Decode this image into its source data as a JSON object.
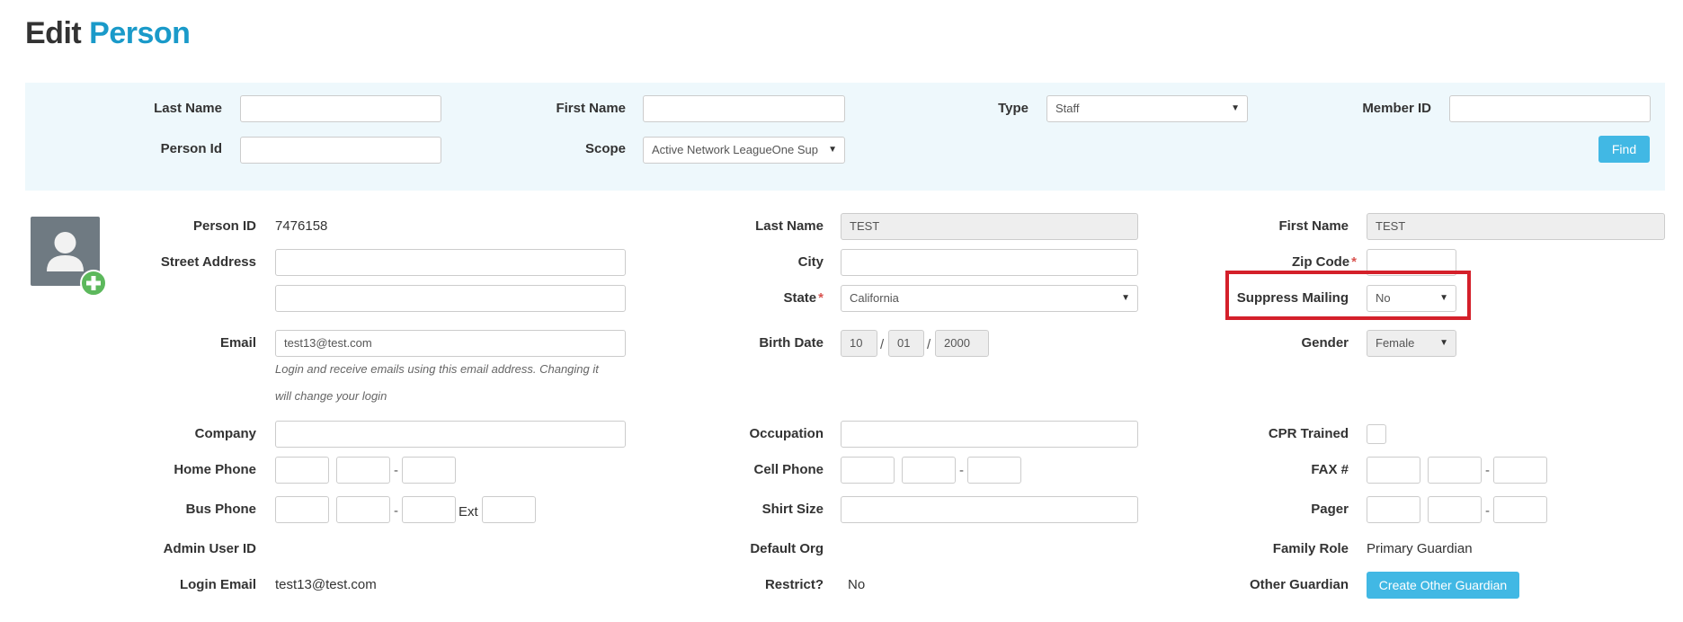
{
  "page": {
    "title_word1": "Edit",
    "title_word2": "Person"
  },
  "search": {
    "last_name_label": "Last Name",
    "last_name_value": "",
    "first_name_label": "First Name",
    "first_name_value": "",
    "type_label": "Type",
    "type_value": "Staff",
    "member_id_label": "Member ID",
    "member_id_value": "",
    "person_id_label": "Person Id",
    "person_id_value": "",
    "scope_label": "Scope",
    "scope_value": "Active Network LeagueOne Sup",
    "find_button": "Find"
  },
  "person": {
    "person_id_label": "Person ID",
    "person_id_value": "7476158",
    "street_address_label": "Street Address",
    "street_address_1": "",
    "street_address_2": "",
    "email_label": "Email",
    "email_value": "test13@test.com",
    "email_note_line1": "Login and receive emails using this email address. Changing it",
    "email_note_line2": "will change your login",
    "company_label": "Company",
    "company_value": "",
    "home_phone_label": "Home Phone",
    "bus_phone_label": "Bus Phone",
    "ext_label": "Ext",
    "admin_user_id_label": "Admin User ID",
    "login_email_label": "Login Email",
    "login_email_value": "test13@test.com",
    "last_name_label": "Last Name",
    "last_name_value": "TEST",
    "city_label": "City",
    "city_value": "",
    "state_label": "State",
    "state_value": "California",
    "birth_date_label": "Birth Date",
    "birth_month": "10",
    "birth_day": "01",
    "birth_year": "2000",
    "date_sep": "/",
    "occupation_label": "Occupation",
    "occupation_value": "",
    "cell_phone_label": "Cell Phone",
    "shirt_size_label": "Shirt Size",
    "shirt_size_value": "",
    "default_org_label": "Default Org",
    "restrict_label": "Restrict?",
    "restrict_value": "No",
    "first_name_label": "First Name",
    "first_name_value": "TEST",
    "zip_code_label": "Zip Code",
    "zip_code_value": "",
    "suppress_mailing_label": "Suppress Mailing",
    "suppress_mailing_value": "No",
    "gender_label": "Gender",
    "gender_value": "Female",
    "cpr_trained_label": "CPR Trained",
    "fax_label": "FAX #",
    "pager_label": "Pager",
    "family_role_label": "Family Role",
    "family_role_value": "Primary Guardian",
    "other_guardian_label": "Other Guardian",
    "create_other_guardian_button": "Create Other Guardian",
    "required_mark": "*",
    "phone_dash": "-"
  },
  "icons": {
    "dropdown": "caret-down-icon",
    "avatar": "user-silhouette-icon",
    "add_photo": "plus-circle-icon"
  },
  "colors": {
    "accent": "#1a9ac9",
    "button": "#41b8e4",
    "highlight": "#d4202a",
    "add": "#5cb85c"
  }
}
